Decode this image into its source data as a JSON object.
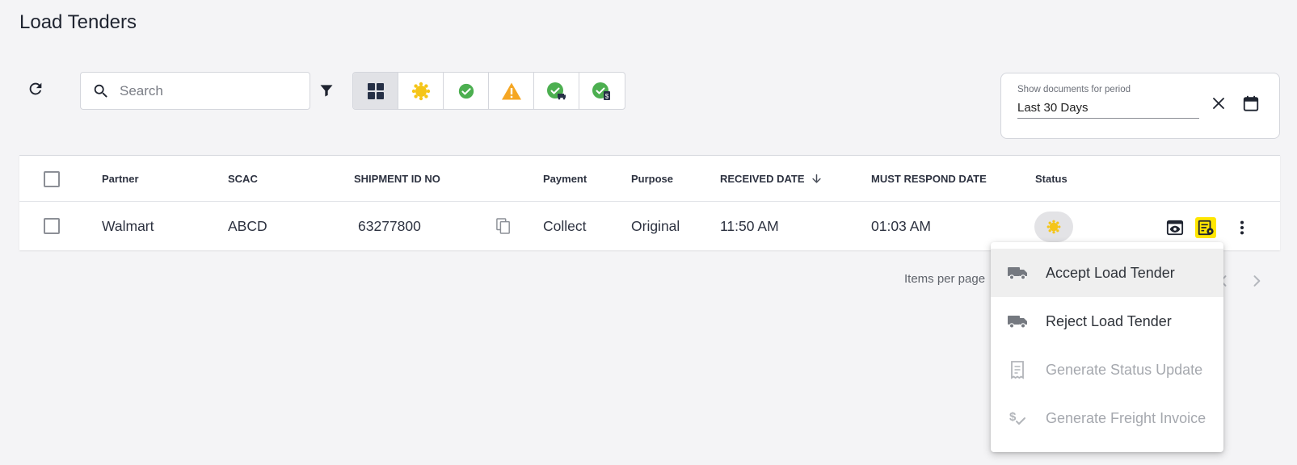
{
  "page": {
    "title": "Load Tenders"
  },
  "toolbar": {
    "search_placeholder": "Search",
    "status_tabs": [
      {
        "name": "all",
        "icon": "grid-icon"
      },
      {
        "name": "pending",
        "icon": "sun-icon"
      },
      {
        "name": "accepted",
        "icon": "check-circle-icon"
      },
      {
        "name": "warning",
        "icon": "warning-triangle-icon"
      },
      {
        "name": "status-updated",
        "icon": "check-truck-icon"
      },
      {
        "name": "invoiced",
        "icon": "check-invoice-icon"
      }
    ]
  },
  "period": {
    "label": "Show documents for period",
    "value": "Last 30 Days"
  },
  "table": {
    "headers": {
      "partner": "Partner",
      "scac": "SCAC",
      "shipment_id": "SHIPMENT ID NO",
      "payment": "Payment",
      "purpose": "Purpose",
      "received_date": "RECEIVED DATE",
      "must_respond_date": "MUST RESPOND DATE",
      "status": "Status"
    },
    "rows": [
      {
        "partner": "Walmart",
        "scac": "ABCD",
        "shipment_id": "63277800",
        "payment": "Collect",
        "purpose": "Original",
        "received_date": "11:50 AM",
        "must_respond_date": "01:03 AM",
        "status": "pending"
      }
    ]
  },
  "paginator": {
    "items_per_page_label": "Items per page"
  },
  "context_menu": {
    "items": [
      {
        "label": "Accept Load Tender",
        "icon": "truck-icon",
        "enabled": true
      },
      {
        "label": "Reject Load Tender",
        "icon": "truck-icon",
        "enabled": true
      },
      {
        "label": "Generate Status Update",
        "icon": "receipt-icon",
        "enabled": false
      },
      {
        "label": "Generate Freight Invoice",
        "icon": "dollar-check-icon",
        "enabled": false
      }
    ]
  },
  "colors": {
    "pending": "#f5c518",
    "success": "#4caf50",
    "warning": "#f5a623",
    "highlight": "#ffe600",
    "text_dark": "#1f2430"
  }
}
